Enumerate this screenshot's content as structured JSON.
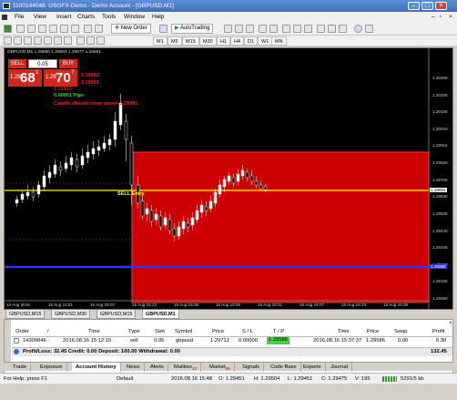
{
  "window": {
    "title": "1100144046: USGFX-Demo - Demo Account - [GBPUSD,M1]"
  },
  "menu": [
    "File",
    "View",
    "Insert",
    "Charts",
    "Tools",
    "Window",
    "Help"
  ],
  "toolbar": {
    "new_order": "New Order",
    "autotrading": "AutoTrading"
  },
  "timeframes": [
    "M1",
    "M5",
    "M15",
    "M30",
    "H1",
    "H4",
    "D1",
    "W1",
    "MN"
  ],
  "chart": {
    "header": "GBPUSD,M1  1.29680 1.29683 1.29677 1.29681",
    "one_click": {
      "sell_label": "SELL",
      "buy_label": "BUY",
      "lot": "0.05",
      "sell_small": "1.29",
      "sell_big": "68",
      "sell_sup": "1",
      "buy_small": "1.29",
      "buy_big": "70",
      "buy_sup": "7"
    },
    "info_red1": "1.29682",
    "info_red2": "1.29991",
    "info_green1": "1.29974",
    "info_green2": "0.00001  Pips",
    "note": "Candle should close above 1.29991",
    "sell_entry": "SELL Entry",
    "y_ticks": [
      "1.30300",
      "1.30200",
      "1.30105",
      "1.30010",
      "1.29915",
      "1.29820",
      "1.29725",
      "1.29630",
      "1.29535",
      "1.29440",
      "1.29345",
      "1.29250",
      "1.29155",
      "1.29060"
    ],
    "current_price": "1.29681",
    "blue_price": "1.29258",
    "x_ticks": [
      "16 Aug 2016",
      "16 Aug 14:51",
      "16 Aug 15:07",
      "16 Aug 15:23",
      "16 Aug 15:39",
      "16 Aug 15:55",
      "16 Aug 15:51",
      "16 Aug 16:07",
      "16 Aug 16:23",
      "16 Aug 16:39"
    ],
    "colors": {
      "zone": "#cc0000",
      "sell_line": "#ffff00",
      "target_line": "#3333ff"
    }
  },
  "symbol_tabs": [
    "GBPUSD,M15",
    "GBPUSD,M30",
    "GBPUSD,M15",
    "GBPUSD,M1"
  ],
  "terminal": {
    "headers": [
      "Order",
      "/",
      "Time",
      "Type",
      "Size",
      "Symbol",
      "Price",
      "S / L",
      "T / P",
      "Time",
      "Price",
      "Swap",
      "Profit"
    ],
    "row": [
      "14309846",
      "2016.08.16 15:12:16",
      "sell",
      "0.05",
      "gbpusd",
      "1.29712",
      "0.00000",
      "1.29586",
      "2016.08.16 15:37:37",
      "1.29586",
      "0.00",
      "6.30"
    ],
    "summary": "Profit/Loss: 32.45  Credit: 0.00  Deposit: 100.00  Withdrawal: 0.00",
    "summary_value": "132.45"
  },
  "bottom_tabs": [
    "Trade",
    "Exposure",
    "Account History",
    "News",
    "Alerts",
    "Mailbox",
    "Market",
    "Signals",
    "Code Base",
    "Experts",
    "Journal"
  ],
  "bottom_badges": {
    "mailbox": "10",
    "market": "59"
  },
  "status": {
    "help": "For Help, press F1",
    "profile": "Default",
    "datetime": "2016.08.16 15:48",
    "open": "O: 1.29451",
    "high": "H: 1.29504",
    "low": "L: 1.29451",
    "close": "C: 1.29475",
    "volume": "V: 195",
    "traffic": "5291/5 kb"
  }
}
